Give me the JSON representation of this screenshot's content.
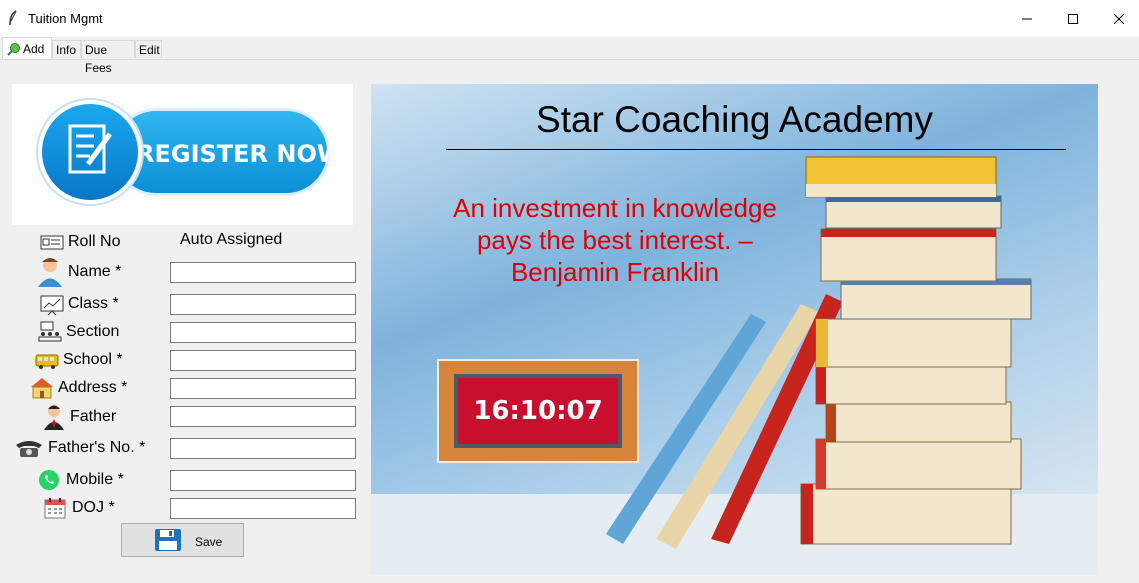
{
  "window": {
    "title": "Tuition Mgmt"
  },
  "tabs": [
    {
      "label": "Add",
      "icon": "search-globe-icon"
    },
    {
      "label": "Info"
    },
    {
      "label": "Due Fees"
    },
    {
      "label": "Edit"
    }
  ],
  "banner": {
    "text": "REGISTER NOW",
    "icon": "document-pen-icon"
  },
  "form": {
    "roll_no": {
      "label": "Roll No",
      "value": "Auto Assigned",
      "icon": "id-card-icon"
    },
    "fields": [
      {
        "label": "Name *",
        "icon": "person-icon",
        "value": ""
      },
      {
        "label": "Class *",
        "icon": "chart-board-icon",
        "value": ""
      },
      {
        "label": "Section",
        "icon": "classroom-icon",
        "value": ""
      },
      {
        "label": "School *",
        "icon": "school-bus-icon",
        "value": ""
      },
      {
        "label": "Address *",
        "icon": "house-icon",
        "value": ""
      },
      {
        "label": "Father",
        "icon": "man-icon",
        "value": ""
      },
      {
        "label": "Father's No. *",
        "icon": "telephone-icon",
        "value": ""
      },
      {
        "label": "Mobile *",
        "icon": "whatsapp-icon",
        "value": ""
      },
      {
        "label": "DOJ *",
        "icon": "calendar-icon",
        "value": ""
      }
    ],
    "save_label": "Save"
  },
  "hero": {
    "title": "Star Coaching Academy",
    "quote": "An investment in knowledge pays the best interest. – Benjamin Franklin",
    "clock": "16:10:07"
  },
  "colors": {
    "quote": "#e00000",
    "clock_bg": "#c8102e",
    "clock_frame": "#d6843a",
    "banner_blue": "#1aa8ee"
  }
}
